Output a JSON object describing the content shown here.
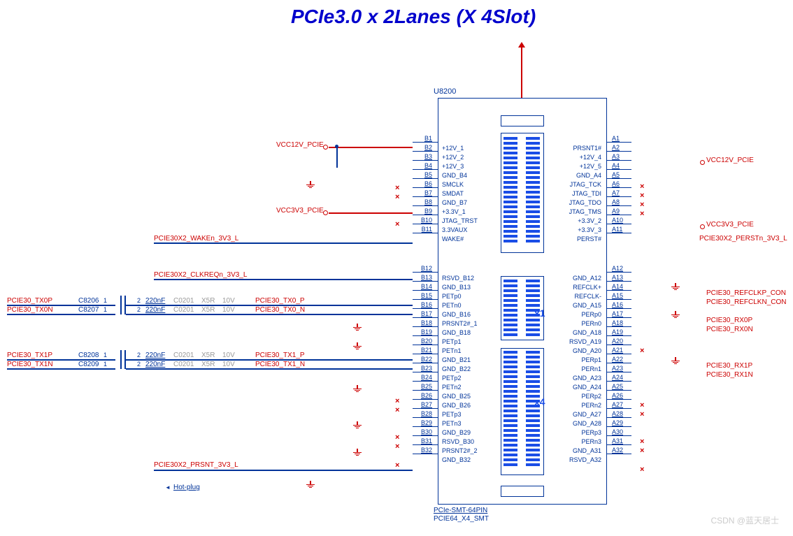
{
  "title": "PCIe3.0 x 2Lanes (X 4Slot)",
  "component": {
    "ref": "U8200",
    "footprint1": "PCIe-SMT-64PIN",
    "footprint2": "PCIE64_X4_SMT"
  },
  "watermark": "CSDN @蓝天居士",
  "hotplug_note": "Hot-plug",
  "slot_labels": {
    "x1": "x1",
    "x4": "x4"
  },
  "power_nets": {
    "vcc12v_left": "VCC12V_PCIE",
    "vcc3v3_left": "VCC3V3_PCIE",
    "vcc12v_right": "VCC12V_PCIE",
    "vcc3v3_right": "VCC3V3_PCIE"
  },
  "signal_nets": {
    "wake": "PCIE30X2_WAKEn_3V3_L",
    "clkreq": "PCIE30X2_CLKREQn_3V3_L",
    "tx0p_left": "PCIE30_TX0P",
    "tx0n_left": "PCIE30_TX0N",
    "tx0p_mid": "PCIE30_TX0_P",
    "tx0n_mid": "PCIE30_TX0_N",
    "tx1p_left": "PCIE30_TX1P",
    "tx1n_left": "PCIE30_TX1N",
    "tx1p_mid": "PCIE30_TX1_P",
    "tx1n_mid": "PCIE30_TX1_N",
    "prsnt": "PCIE30X2_PRSNT_3V3_L",
    "perst": "PCIE30X2_PERSTn_3V3_L",
    "refclkp": "PCIE30_REFCLKP_CON",
    "refclkn": "PCIE30_REFCLKN_CON",
    "rx0p": "PCIE30_RX0P",
    "rx0n": "PCIE30_RX0N",
    "rx1p": "PCIE30_RX1P",
    "rx1n": "PCIE30_RX1N"
  },
  "caps": {
    "c8206": {
      "ref": "C8206",
      "val": "220nF",
      "pkg": "C0201",
      "die": "X5R",
      "v": "10V",
      "p1": "1",
      "p2": "2"
    },
    "c8207": {
      "ref": "C8207",
      "val": "220nF",
      "pkg": "C0201",
      "die": "X5R",
      "v": "10V",
      "p1": "1",
      "p2": "2"
    },
    "c8208": {
      "ref": "C8208",
      "val": "220nF",
      "pkg": "C0201",
      "die": "X5R",
      "v": "10V",
      "p1": "1",
      "p2": "2"
    },
    "c8209": {
      "ref": "C8209",
      "val": "220nF",
      "pkg": "C0201",
      "die": "X5R",
      "v": "10V",
      "p1": "1",
      "p2": "2"
    }
  },
  "pins_b": [
    {
      "n": "B1",
      "l": ""
    },
    {
      "n": "B2",
      "l": "+12V_1"
    },
    {
      "n": "B3",
      "l": "+12V_2"
    },
    {
      "n": "B4",
      "l": "+12V_3"
    },
    {
      "n": "B5",
      "l": "GND_B4"
    },
    {
      "n": "B6",
      "l": "SMCLK"
    },
    {
      "n": "B7",
      "l": "SMDAT"
    },
    {
      "n": "B8",
      "l": "GND_B7"
    },
    {
      "n": "B9",
      "l": "+3.3V_1"
    },
    {
      "n": "B10",
      "l": "JTAG_TRST"
    },
    {
      "n": "B11",
      "l": "3.3VAUX"
    },
    {
      "n": "",
      "l": "WAKE#"
    },
    {
      "n": "B12",
      "l": ""
    },
    {
      "n": "B13",
      "l": "RSVD_B12"
    },
    {
      "n": "B14",
      "l": "GND_B13"
    },
    {
      "n": "B15",
      "l": "PETp0"
    },
    {
      "n": "B16",
      "l": "PETn0"
    },
    {
      "n": "B17",
      "l": "GND_B16"
    },
    {
      "n": "B18",
      "l": "PRSNT2#_1"
    },
    {
      "n": "B19",
      "l": "GND_B18"
    },
    {
      "n": "B20",
      "l": "PETp1"
    },
    {
      "n": "B21",
      "l": "PETn1"
    },
    {
      "n": "B22",
      "l": "GND_B21"
    },
    {
      "n": "B23",
      "l": "GND_B22"
    },
    {
      "n": "B24",
      "l": "PETp2"
    },
    {
      "n": "B25",
      "l": "PETn2"
    },
    {
      "n": "B26",
      "l": "GND_B25"
    },
    {
      "n": "B27",
      "l": "GND_B26"
    },
    {
      "n": "B28",
      "l": "PETp3"
    },
    {
      "n": "B29",
      "l": "PETn3"
    },
    {
      "n": "B30",
      "l": "GND_B29"
    },
    {
      "n": "B31",
      "l": "RSVD_B30"
    },
    {
      "n": "B32",
      "l": "PRSNT2#_2"
    },
    {
      "n": "",
      "l": "GND_B32"
    }
  ],
  "pins_a": [
    {
      "n": "A1",
      "l": ""
    },
    {
      "n": "A2",
      "l": "PRSNT1#"
    },
    {
      "n": "A3",
      "l": "+12V_4"
    },
    {
      "n": "A4",
      "l": "+12V_5"
    },
    {
      "n": "A5",
      "l": "GND_A4"
    },
    {
      "n": "A6",
      "l": "JTAG_TCK"
    },
    {
      "n": "A7",
      "l": "JTAG_TDI"
    },
    {
      "n": "A8",
      "l": "JTAG_TDO"
    },
    {
      "n": "A9",
      "l": "JTAG_TMS"
    },
    {
      "n": "A10",
      "l": "+3.3V_2"
    },
    {
      "n": "A11",
      "l": "+3.3V_3"
    },
    {
      "n": "",
      "l": "PERST#"
    },
    {
      "n": "A12",
      "l": ""
    },
    {
      "n": "A13",
      "l": "GND_A12"
    },
    {
      "n": "A14",
      "l": "REFCLK+"
    },
    {
      "n": "A15",
      "l": "REFCLK-"
    },
    {
      "n": "A16",
      "l": "GND_A15"
    },
    {
      "n": "A17",
      "l": "PERp0"
    },
    {
      "n": "A18",
      "l": "PERn0"
    },
    {
      "n": "A19",
      "l": "GND_A18"
    },
    {
      "n": "A20",
      "l": "RSVD_A19"
    },
    {
      "n": "A21",
      "l": "GND_A20"
    },
    {
      "n": "A22",
      "l": "PERp1"
    },
    {
      "n": "A23",
      "l": "PERn1"
    },
    {
      "n": "A24",
      "l": "GND_A23"
    },
    {
      "n": "A25",
      "l": "GND_A24"
    },
    {
      "n": "A26",
      "l": "PERp2"
    },
    {
      "n": "A27",
      "l": "PERn2"
    },
    {
      "n": "A28",
      "l": "GND_A27"
    },
    {
      "n": "A29",
      "l": "GND_A28"
    },
    {
      "n": "A30",
      "l": "PERp3"
    },
    {
      "n": "A31",
      "l": "PERn3"
    },
    {
      "n": "A32",
      "l": "GND_A31"
    },
    {
      "n": "",
      "l": "RSVD_A32"
    }
  ]
}
